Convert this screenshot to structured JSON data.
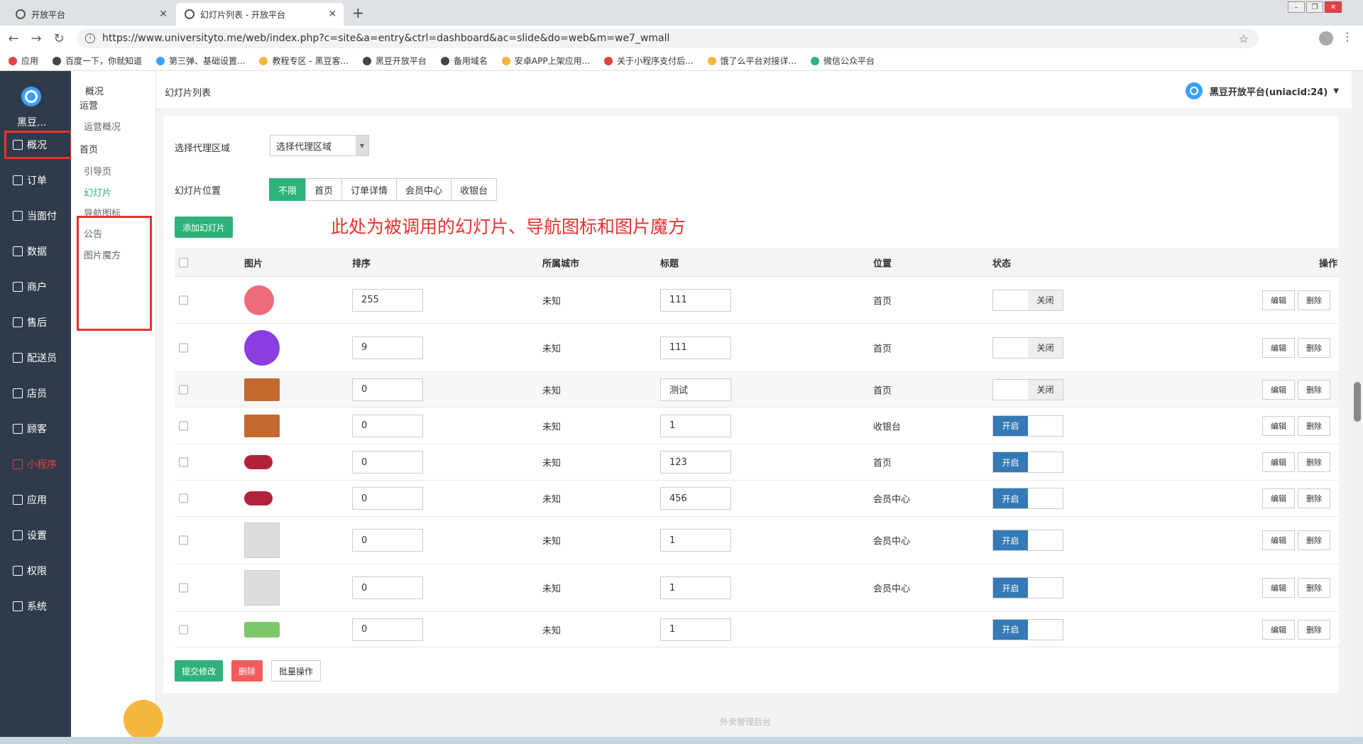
{
  "browser": {
    "tabs": [
      {
        "title": "开放平台"
      },
      {
        "title": "幻灯片列表 - 开放平台"
      }
    ],
    "url": "https://www.universityto.me/web/index.php?c=site&a=entry&ctrl=dashboard&ac=slide&do=web&m=we7_wmall",
    "bookmarks": [
      {
        "label": "应用",
        "color": "#e04343"
      },
      {
        "label": "百度一下，你就知道",
        "color": "#444"
      },
      {
        "label": "第三弹、基础设置...",
        "color": "#3aa0ff"
      },
      {
        "label": "教程专区 - 黑豆客...",
        "color": "#f4b63c"
      },
      {
        "label": "黑豆开放平台",
        "color": "#444"
      },
      {
        "label": "备用域名",
        "color": "#444"
      },
      {
        "label": "安卓APP上架应用...",
        "color": "#f4b63c"
      },
      {
        "label": "关于小程序支付后...",
        "color": "#e04343"
      },
      {
        "label": "饿了么平台对接详...",
        "color": "#f4b63c"
      },
      {
        "label": "微信公众平台",
        "color": "#2eb27a"
      }
    ]
  },
  "sidebar": {
    "brand": "黑豆...",
    "items": [
      {
        "label": "概况",
        "icon": "overview-icon"
      },
      {
        "label": "订单",
        "icon": "order-icon"
      },
      {
        "label": "当面付",
        "icon": "pay-icon"
      },
      {
        "label": "数据",
        "icon": "data-icon"
      },
      {
        "label": "商户",
        "icon": "store-icon"
      },
      {
        "label": "售后",
        "icon": "aftersale-icon"
      },
      {
        "label": "配送员",
        "icon": "courier-icon"
      },
      {
        "label": "店员",
        "icon": "clerk-icon"
      },
      {
        "label": "顾客",
        "icon": "customer-icon"
      },
      {
        "label": "小程序",
        "icon": "miniapp-icon"
      },
      {
        "label": "应用",
        "icon": "apps-icon"
      },
      {
        "label": "设置",
        "icon": "settings-icon"
      },
      {
        "label": "权限",
        "icon": "permission-icon"
      },
      {
        "label": "系统",
        "icon": "system-icon"
      }
    ]
  },
  "subnav": {
    "header": "概况",
    "section1": "运营",
    "item_overview": "运营概况",
    "section2": "首页",
    "items": [
      "引导页",
      "幻灯片",
      "导航图标",
      "公告",
      "图片魔方"
    ]
  },
  "header": {
    "page_title": "幻灯片列表",
    "user": "黑豆开放平台(uniacid:24)"
  },
  "filters": {
    "region_label": "选择代理区域",
    "region_value": "选择代理区域",
    "position_label": "幻灯片位置",
    "positions": [
      "不限",
      "首页",
      "订单详情",
      "会员中心",
      "收银台"
    ],
    "add_label": "添加幻灯片",
    "annotation": "此处为被调用的幻灯片、导航图标和图片魔方"
  },
  "table": {
    "headers": {
      "img": "图片",
      "order": "排序",
      "city": "所属城市",
      "title": "标题",
      "position": "位置",
      "status": "状态",
      "ops": "操作"
    },
    "edit_label": "编辑",
    "delete_label": "删除",
    "on_label": "开启",
    "off_label": "关闭",
    "rows": [
      {
        "order": "255",
        "city": "未知",
        "title": "111",
        "position": "首页",
        "status": "off",
        "img": "heart"
      },
      {
        "order": "9",
        "city": "未知",
        "title": "111",
        "position": "首页",
        "status": "off",
        "img": "user"
      },
      {
        "order": "0",
        "city": "未知",
        "title": "测试",
        "position": "首页",
        "status": "off",
        "img": "food"
      },
      {
        "order": "0",
        "city": "未知",
        "title": "1",
        "position": "收银台",
        "status": "on",
        "img": "food"
      },
      {
        "order": "0",
        "city": "未知",
        "title": "123",
        "position": "首页",
        "status": "on",
        "img": "berries"
      },
      {
        "order": "0",
        "city": "未知",
        "title": "456",
        "position": "会员中心",
        "status": "on",
        "img": "berries"
      },
      {
        "order": "0",
        "city": "未知",
        "title": "1",
        "position": "会员中心",
        "status": "on",
        "img": "placeholder"
      },
      {
        "order": "0",
        "city": "未知",
        "title": "1",
        "position": "会员中心",
        "status": "on",
        "img": "placeholder"
      },
      {
        "order": "0",
        "city": "未知",
        "title": "1",
        "position": "",
        "status": "on",
        "img": "banner"
      }
    ]
  },
  "footer": {
    "submit": "提交修改",
    "delete": "删除",
    "batch": "批量操作",
    "text": "外卖管理后台"
  }
}
